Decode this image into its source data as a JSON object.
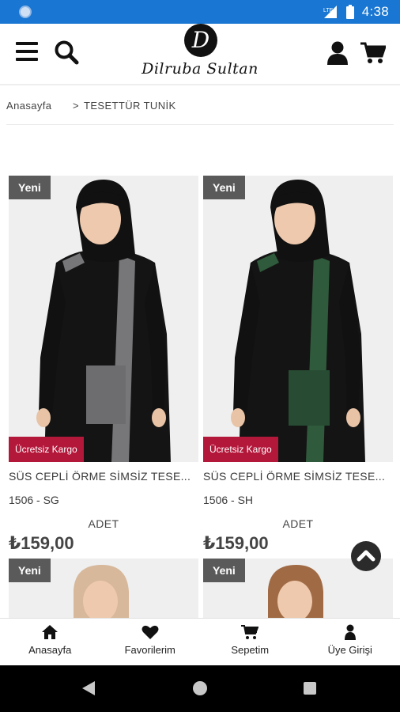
{
  "status_bar": {
    "time": "4:38",
    "network": "LTE"
  },
  "header": {
    "logo_mark": "D",
    "logo_text": "Dilruba Sultan",
    "menu_icon": "hamburger-icon",
    "search_icon": "search-icon",
    "user_icon": "user-icon",
    "cart_icon": "cart-icon"
  },
  "breadcrumb": {
    "home": "Anasayfa",
    "separator": ">",
    "current": "TESETTÜR TUNİK"
  },
  "products": [
    {
      "badge_new": "Yeni",
      "badge_shipping": "Ücretsiz Kargo",
      "name": "SÜS CEPLİ ÖRME SİMSİZ TESE...",
      "code": "1506 - SG",
      "unit": "ADET",
      "price": "₺159,00",
      "accent_color": "#77777a"
    },
    {
      "badge_new": "Yeni",
      "badge_shipping": "Ücretsiz Kargo",
      "name": "SÜS CEPLİ ÖRME SİMSİZ TESE...",
      "code": "1506 - SH",
      "unit": "ADET",
      "price": "₺159,00",
      "accent_color": "#2f5a3c"
    },
    {
      "badge_new": "Yeni",
      "scarf_color": "#d7b89a"
    },
    {
      "badge_new": "Yeni",
      "scarf_color": "#a06a45"
    }
  ],
  "bottom_nav": [
    {
      "label": "Anasayfa",
      "icon": "home-icon"
    },
    {
      "label": "Favorilerim",
      "icon": "heart-icon"
    },
    {
      "label": "Sepetim",
      "icon": "cart-icon"
    },
    {
      "label": "Üye Girişi",
      "icon": "user-icon"
    }
  ],
  "colors": {
    "status_bar": "#1976d2",
    "badge_new": "#5a5a5a",
    "badge_shipping": "#b3173a",
    "text": "#333333"
  }
}
